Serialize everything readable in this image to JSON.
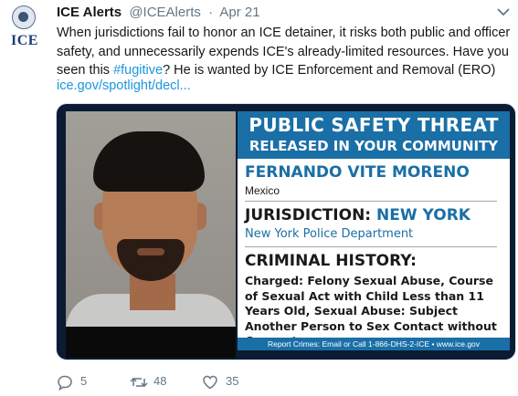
{
  "tweet": {
    "account": {
      "display_name": "ICE Alerts",
      "handle": "@ICEAlerts",
      "separator": "·",
      "date": "Apr 21",
      "avatar_text": "ICE"
    },
    "text": {
      "line_a": "When jurisdictions fail to honor an ICE detainer, it risks both public and officer safety, and unnecessarily expends ICE's already-limited resources. Have you seen this ",
      "hashtag": "#fugitive",
      "line_b": "? He is wanted by ICE Enforcement and Removal (ERO)",
      "link": "ice.gov/spotlight/decl..."
    },
    "media": {
      "title_line1": "PUBLIC SAFETY THREAT",
      "title_line2": "RELEASED IN YOUR COMMUNITY",
      "person_name": "FERNANDO VITE MORENO",
      "country": "Mexico",
      "jurisdiction_label": "JURISDICTION:",
      "jurisdiction_value": "NEW YORK",
      "department": "New York Police Department",
      "criminal_history_label": "CRIMINAL HISTORY:",
      "charges": "Charged: Felony Sexual Abuse, Course of Sexual Act with Child Less than 11 Years Old, Sexual Abuse: Subject Another Person to Sex Contact without Consent",
      "footer": "Report Crimes: Email or Call 1-866-DHS-2-ICE  •  www.ice.gov"
    },
    "actions": {
      "replies": "5",
      "retweets": "48",
      "likes": "35"
    }
  },
  "colors": {
    "link": "#1b95e0",
    "muted": "#657786",
    "poster_blue": "#1a6fa6"
  }
}
